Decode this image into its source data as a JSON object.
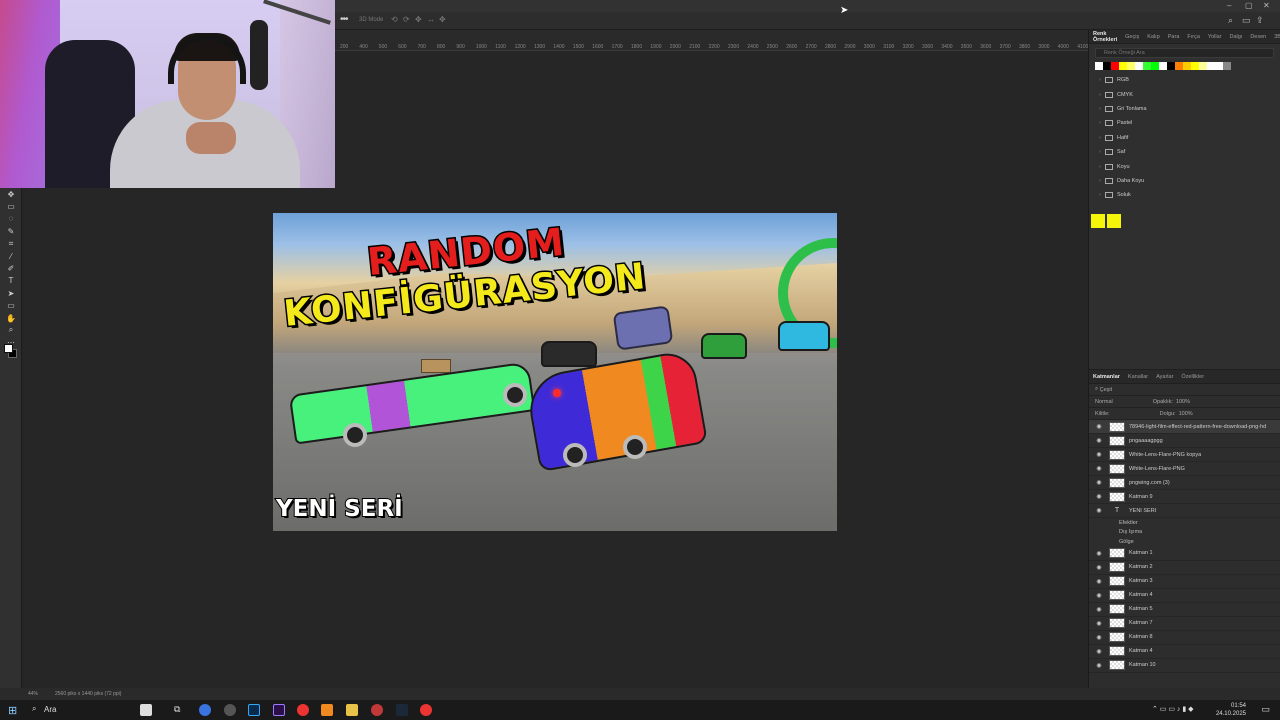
{
  "menu": {
    "window_controls": [
      "–",
      "▢",
      "✕"
    ]
  },
  "options_bar": {
    "items": [
      "3D Mode",
      "⟲",
      "⟳",
      "✥",
      "↔",
      "✥"
    ]
  },
  "ruler": {
    "marks": [
      "200",
      "400",
      "500",
      "600",
      "700",
      "800",
      "900",
      "1000",
      "1100",
      "1200",
      "1300",
      "1400",
      "1500",
      "1600",
      "1700",
      "1800",
      "1900",
      "2000",
      "2100",
      "2200",
      "2300",
      "2400",
      "2500",
      "2600",
      "2700",
      "2800",
      "2900",
      "3000",
      "3100",
      "3200",
      "3300",
      "3400",
      "3500",
      "3600",
      "3700",
      "3800",
      "3900",
      "4000",
      "4100"
    ]
  },
  "document": {
    "title_line1": "RANDOM",
    "title_line2": "KONFİGÜRASYON",
    "badge": "YENİ SERİ"
  },
  "swatches_panel": {
    "tabs": [
      "Renk Örnekleri",
      "Geçiş",
      "Kalıp",
      "Para",
      "Fırça",
      "Yollar",
      "Dalgı",
      "Desen",
      "3B"
    ],
    "search_placeholder": "Renk Örneği Ara",
    "recent_colors": [
      "#ffffff",
      "#000000",
      "#ff0000",
      "#ffff00",
      "#ffff66",
      "#ffffff",
      "#33ff33",
      "#00ff00",
      "#ffffff",
      "#000000",
      "#ff8000",
      "#ffcc00",
      "#ffff00",
      "#ffff99",
      "#ffffff",
      "#ffffff",
      "#888888"
    ],
    "folders": [
      "RGB",
      "CMYK",
      "Gri Tonlama",
      "Pastel",
      "Hafif",
      "Saf",
      "Koyu",
      "Daha Koyu",
      "Soluk"
    ]
  },
  "layers_panel": {
    "tabs": [
      "Katmanlar",
      "Kanallar",
      "Ayarlar",
      "Özellikler"
    ],
    "filter_label": "Çeşit",
    "blend_mode": "Normal",
    "opacity_label": "Opaklık:",
    "opacity_value": "100%",
    "lock_label": "Kilitle:",
    "fill_label": "Dolgu:",
    "fill_value": "100%",
    "layers": [
      {
        "name": "78946-light-film-effect-red-pattern-free-download-png-hd",
        "selected": true
      },
      {
        "name": "pngaaaagpgg",
        "selected": false
      },
      {
        "name": "White-Lens-Flare-PNG kopya",
        "selected": false
      },
      {
        "name": "White-Lens-Flare-PNG",
        "selected": false
      },
      {
        "name": "pngwing.com (3)",
        "selected": false
      },
      {
        "name": "Katman 9",
        "selected": false
      },
      {
        "name": "YENİ SERİ",
        "selected": false,
        "type": "text"
      }
    ],
    "effects": [
      "Efektler",
      "Dış Işıma",
      "Gölge"
    ],
    "layers_after": [
      "Katman 1",
      "Katman 2",
      "Katman 3",
      "Katman 4",
      "Katman 5",
      "Katman 7",
      "Katman 8",
      "Katman 4",
      "Katman 10"
    ]
  },
  "status": {
    "zoom": "44%",
    "size": "2560 piks x 1440 piks (72 ppi)"
  },
  "taskbar": {
    "search_label": "Ara",
    "time": "01:54",
    "date": "24.10.2025"
  }
}
